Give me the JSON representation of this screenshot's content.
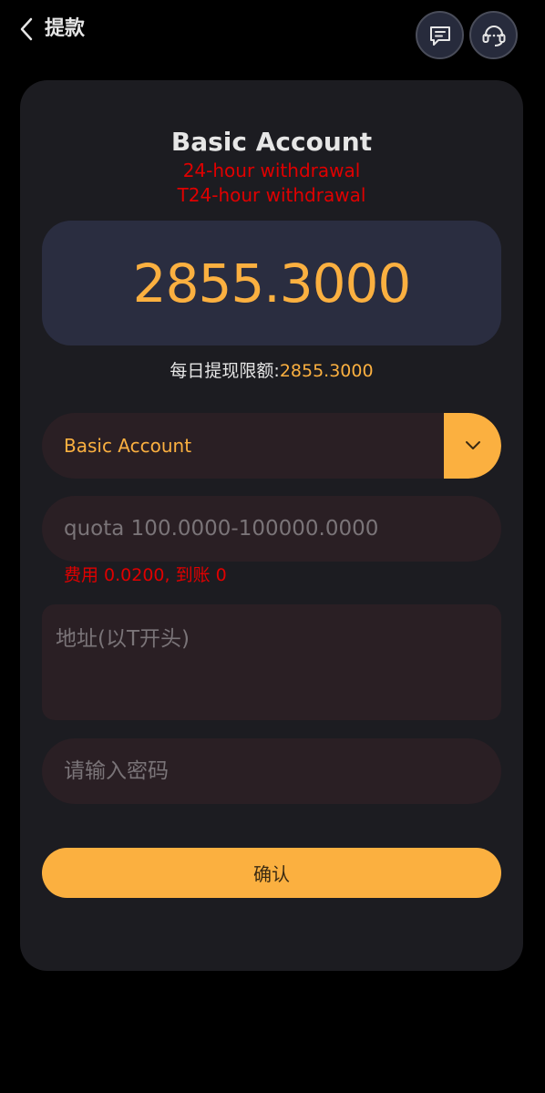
{
  "header": {
    "title": "提款",
    "back_icon": "chevron-left-icon",
    "message_icon": "message-icon",
    "support_icon": "headset-icon"
  },
  "card": {
    "account_title": "Basic Account",
    "notice_line1": "24-hour withdrawal",
    "notice_line2": "T24-hour withdrawal",
    "balance": "2855.3000",
    "daily_limit_label": "每日提现限额:",
    "daily_limit_value": "2855.3000"
  },
  "form": {
    "account_select": {
      "selected": "Basic Account",
      "icon": "chevron-down-icon"
    },
    "amount": {
      "placeholder": "quota 100.0000-100000.0000",
      "value": ""
    },
    "fee_text": "费用 0.0200, 到账 0",
    "address": {
      "placeholder": "地址(以T开头)",
      "value": ""
    },
    "password": {
      "placeholder": "请输入密码",
      "value": ""
    },
    "confirm_label": "确认"
  },
  "colors": {
    "background": "#000000",
    "card": "#1c1c21",
    "accent": "#fbb040",
    "warning": "#e00000",
    "balance_box": "#2a2d40",
    "field": "#2a1f24"
  }
}
